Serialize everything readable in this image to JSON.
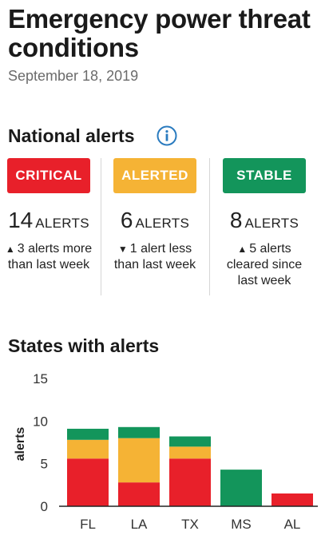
{
  "header": {
    "title": "Emergency power threat conditions",
    "date": "September 18, 2019"
  },
  "national_alerts": {
    "heading": "National alerts",
    "info_icon": "info-icon",
    "columns": [
      {
        "status": "CRITICAL",
        "color": "#e8202a",
        "count": "14",
        "unit": "ALERTS",
        "arrow": "▲",
        "change": "3 alerts more than last week"
      },
      {
        "status": "ALERTED",
        "color": "#f5b335",
        "count": "6",
        "unit": "ALERTS",
        "arrow": "▼",
        "change": "1 alert less than last week"
      },
      {
        "status": "STABLE",
        "color": "#13955b",
        "count": "8",
        "unit": "ALERTS",
        "arrow": "▲",
        "change": "5 alerts cleared since last week"
      }
    ]
  },
  "states": {
    "heading": "States with alerts"
  },
  "chart_data": {
    "type": "bar",
    "stacked": true,
    "categories": [
      "FL",
      "LA",
      "TX",
      "MS",
      "AL"
    ],
    "series": [
      {
        "name": "",
        "color": "#e8202a",
        "values": [
          5.6,
          2.8,
          5.6,
          0,
          1.5
        ]
      },
      {
        "name": "",
        "color": "#f5b335",
        "values": [
          2.2,
          5.2,
          1.4,
          0,
          0
        ]
      },
      {
        "name": "",
        "color": "#13955b",
        "values": [
          1.3,
          1.3,
          1.2,
          4.3,
          0
        ]
      }
    ],
    "ylabel": "alerts",
    "yticks": [
      0,
      5,
      10,
      15
    ],
    "ylim": [
      0,
      15
    ],
    "grid": false
  }
}
